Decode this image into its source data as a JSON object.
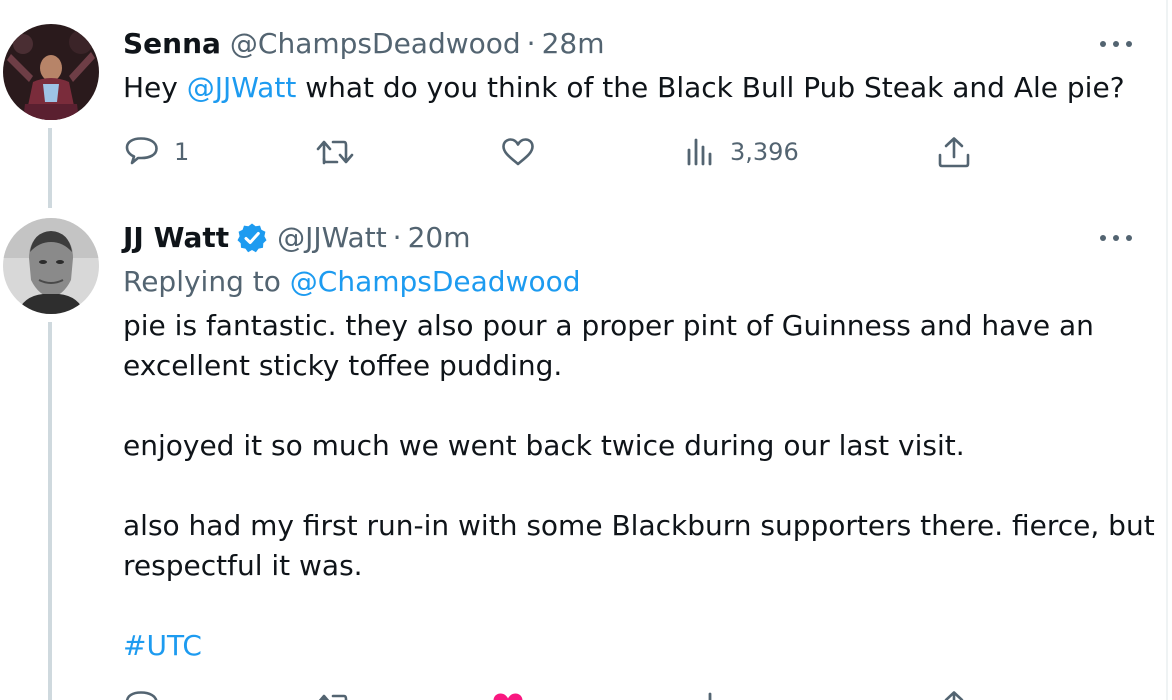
{
  "tweet1": {
    "display_name": "Senna",
    "handle": "@ChampsDeadwood",
    "separator": "·",
    "time": "28m",
    "text_before": "Hey ",
    "mention": "@JJWatt",
    "text_after": " what do you think of the Black Bull Pub Steak and Ale pie?",
    "reply_count": "1",
    "views_count": "3,396"
  },
  "tweet2": {
    "display_name": "JJ Watt",
    "handle": "@JJWatt",
    "separator": "·",
    "time": "20m",
    "replying_prefix": "Replying to ",
    "replying_to": "@ChampsDeadwood",
    "para1_line1": "pie is fantastic. they also pour a proper pint of Guinness and have an",
    "para1_line2": "excellent sticky toffee pudding.",
    "para2": "enjoyed it so much we went back twice during our last visit.",
    "para3_line1": "also had my first run-in with some Blackburn supporters there. fierce, but",
    "para3_line2": "respectful it was.",
    "hashtag": "#UTC"
  },
  "icons": {
    "reply": "reply-icon",
    "retweet": "retweet-icon",
    "like": "heart-icon",
    "views": "views-icon",
    "share": "share-icon",
    "more": "more-icon",
    "verified": "verified-badge-icon"
  },
  "colors": {
    "link": "#1d9bf0",
    "secondary_text": "#536471",
    "primary_text": "#0f1419",
    "thread_line": "#cfd9de",
    "liked_heart": "#f91880"
  }
}
